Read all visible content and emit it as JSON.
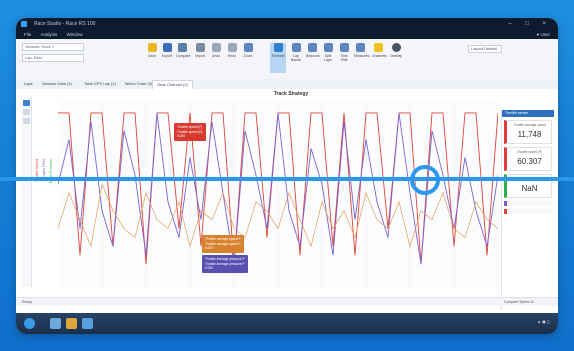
{
  "window": {
    "title": "Race Studio - Race RS 100",
    "controls": "–  □  ×"
  },
  "menu": {
    "items": [
      "File",
      "Analysis",
      "Window"
    ],
    "user": "● User"
  },
  "ribbon": {
    "fields": [
      "Session:  Race 1",
      "Lap:  Best"
    ],
    "view_select": "Layout  Default",
    "buttons": [
      "Save",
      "Export",
      "Compare",
      "Import",
      "Undo",
      "Redo",
      "Zoom",
      "Timeline",
      "Lap Bands",
      "Beacons",
      "Split Laps",
      "Time Shift",
      "Measures",
      "Channels",
      "Overlay"
    ]
  },
  "tabs": [
    "Laps",
    "Session Data (1)",
    "Total GPS Lap (1)",
    "Tables Chart (3)",
    "Gear Channel (2)"
  ],
  "plot": {
    "title": "Track Strategy"
  },
  "y_labels": [
    "Throttle Speed",
    "Engine RPM",
    "Brake Pressure"
  ],
  "tooltips": {
    "red": [
      "Throttle speed (F)",
      "Throttle speed (R)",
      "0.000"
    ],
    "orange": [
      "Throttle average speed P",
      "Throttle average speed P",
      "0.000"
    ],
    "purple": [
      "Throttle Average pressure P",
      "Throttle Average pressure P",
      "0.000"
    ]
  },
  "right_panel": {
    "header": "Throttle sensor",
    "cards": [
      {
        "label": "Throttle average speed",
        "value": "11,748",
        "accent": "#e23b3b"
      },
      {
        "label": "Throttle speed (P)",
        "value": "60.307",
        "accent": "#e23b3b"
      },
      {
        "label": "Throttle speed (P)",
        "value": "NaN",
        "accent": "#2bb34a"
      }
    ]
  },
  "status": {
    "left": "Ready",
    "right": "Compare  Speed 1x"
  },
  "chart_data": {
    "type": "line",
    "series": [
      {
        "color": "#e0443c",
        "values": [
          0.95,
          0.95,
          0.15,
          0.95,
          0.95,
          0.2,
          0.95,
          0.95,
          0.1,
          0.95,
          0.95,
          0.3,
          0.95,
          0.2,
          0.95,
          0.95,
          0.1,
          0.95,
          0.95,
          0.25,
          0.95,
          0.95,
          0.15,
          0.95,
          0.95,
          0.2,
          0.95,
          0.15,
          0.95,
          0.95,
          0.3,
          0.95,
          0.95,
          0.1,
          0.95,
          0.95,
          0.2,
          0.95,
          0.95,
          0.15,
          0.95
        ]
      },
      {
        "color": "#7a63d4",
        "values": [
          0.55,
          0.8,
          0.3,
          0.9,
          0.4,
          0.2,
          0.85,
          0.6,
          0.15,
          0.95,
          0.45,
          0.25,
          0.7,
          0.35,
          0.9,
          0.5,
          0.1,
          0.85,
          0.6,
          0.3,
          0.95,
          0.4,
          0.2,
          0.75,
          0.55,
          0.15,
          0.9,
          0.35,
          0.8,
          0.45,
          0.25,
          0.95,
          0.5,
          0.1,
          0.85,
          0.6,
          0.3,
          0.7,
          0.4,
          0.2,
          0.6
        ]
      },
      {
        "color": "#e79b57",
        "values": [
          0.3,
          0.5,
          0.35,
          0.2,
          0.55,
          0.4,
          0.3,
          0.25,
          0.5,
          0.35,
          0.3,
          0.45,
          0.2,
          0.4,
          0.35,
          0.5,
          0.3,
          0.25,
          0.45,
          0.4,
          0.3,
          0.5,
          0.35,
          0.2,
          0.45,
          0.3,
          0.4,
          0.25,
          0.5,
          0.35,
          0.3,
          0.45,
          0.2,
          0.4,
          0.35,
          0.5,
          0.3,
          0.25,
          0.45,
          0.35,
          0.3
        ]
      }
    ]
  }
}
